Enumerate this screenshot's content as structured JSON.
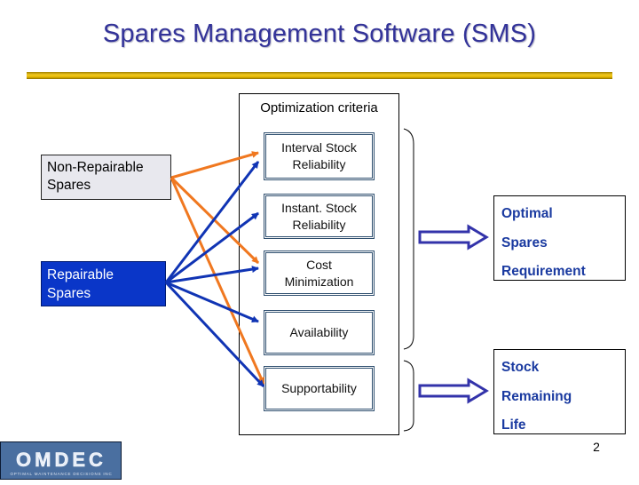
{
  "slide": {
    "title": "Spares Management Software (SMS)",
    "page_number": "2"
  },
  "sources": [
    {
      "id": "non_repairable",
      "label": "Non-Repairable\nSpares",
      "color": "#f07820"
    },
    {
      "id": "repairable",
      "label": "Repairable\nSpares",
      "color": "#1034b4"
    }
  ],
  "criteria_group": {
    "title": "Optimization criteria",
    "items": [
      {
        "id": "interval",
        "label": "Interval Stock\nReliability"
      },
      {
        "id": "instant",
        "label": "Instant. Stock\nReliability"
      },
      {
        "id": "cost",
        "label": "Cost\nMinimization"
      },
      {
        "id": "availability",
        "label": "Availability"
      },
      {
        "id": "supportability",
        "label": "Supportability"
      }
    ]
  },
  "connections": [
    {
      "from": "non_repairable",
      "to": "interval"
    },
    {
      "from": "non_repairable",
      "to": "cost"
    },
    {
      "from": "non_repairable",
      "to": "supportability"
    },
    {
      "from": "repairable",
      "to": "interval"
    },
    {
      "from": "repairable",
      "to": "instant"
    },
    {
      "from": "repairable",
      "to": "cost"
    },
    {
      "from": "repairable",
      "to": "availability"
    },
    {
      "from": "repairable",
      "to": "supportability"
    }
  ],
  "outputs": [
    {
      "id": "optimal",
      "covers": [
        "interval",
        "instant",
        "cost",
        "availability"
      ],
      "lines": [
        "Optimal",
        "Spares",
        "Requirement"
      ]
    },
    {
      "id": "stock_life",
      "covers": [
        "supportability"
      ],
      "lines": [
        "Stock",
        "Remaining",
        "Life"
      ]
    }
  ],
  "logo": {
    "text": "OMDEC",
    "subtext": "OPTIMAL MAINTENANCE DECISIONS INC"
  },
  "colors": {
    "title": "#333399",
    "output_text": "#1a3aa0",
    "output_arrow": "#3333aa",
    "gold_bar": "#e6b800"
  }
}
